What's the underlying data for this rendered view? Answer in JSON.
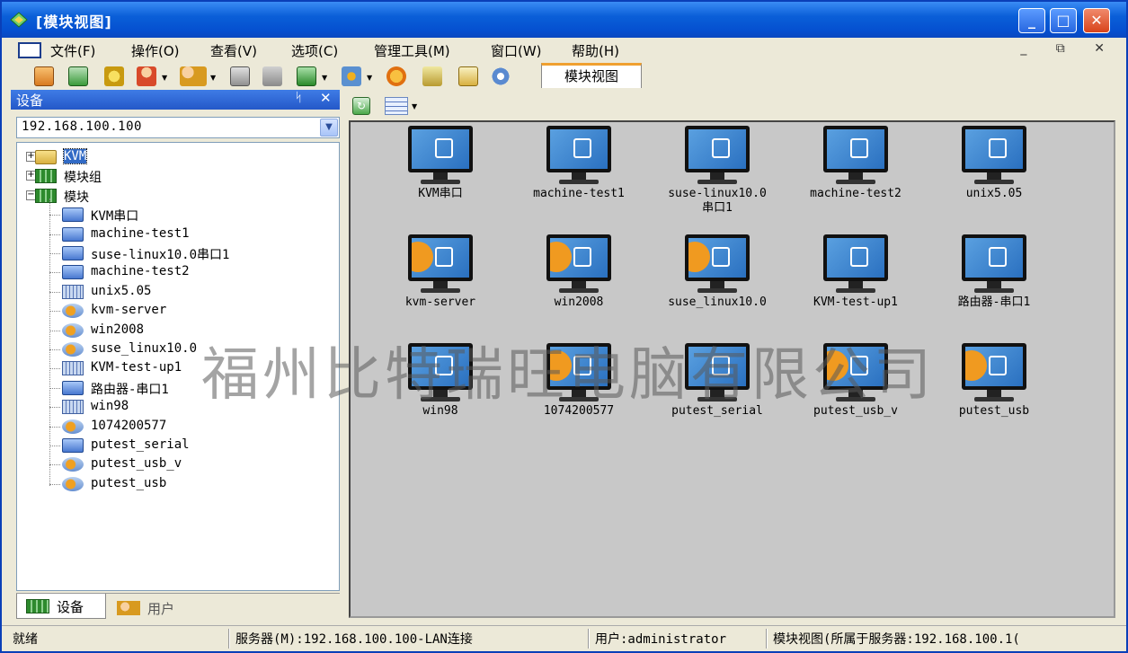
{
  "window": {
    "title": "[模块视图]"
  },
  "menu": [
    "文件(F)",
    "操作(O)",
    "查看(V)",
    "选项(C)",
    "管理工具(M)",
    "窗口(W)",
    "帮助(H)"
  ],
  "mdi_controls": "_ ⧉ ✕",
  "document_tab": "模块视图",
  "left_panel": {
    "title": "设备",
    "pin": "ᛋ",
    "close": "✕",
    "server": "192.168.100.100",
    "tree": [
      {
        "label": "KVM",
        "icon": "folder",
        "level": 0,
        "expander": "+",
        "selected": true
      },
      {
        "label": "模块组",
        "icon": "group",
        "level": 0,
        "expander": "+"
      },
      {
        "label": "模块",
        "icon": "group",
        "level": 0,
        "expander": "−"
      },
      {
        "label": "KVM串口",
        "icon": "serial",
        "level": 1
      },
      {
        "label": "machine-test1",
        "icon": "serial",
        "level": 1
      },
      {
        "label": "suse-linux10.0串口1",
        "icon": "serial",
        "level": 1
      },
      {
        "label": "machine-test2",
        "icon": "serial",
        "level": 1
      },
      {
        "label": "unix5.05",
        "icon": "kbd",
        "level": 1
      },
      {
        "label": "kvm-server",
        "icon": "usb",
        "level": 1
      },
      {
        "label": "win2008",
        "icon": "usb",
        "level": 1
      },
      {
        "label": "suse_linux10.0",
        "icon": "usb",
        "level": 1
      },
      {
        "label": "KVM-test-up1",
        "icon": "kbd",
        "level": 1
      },
      {
        "label": "路由器-串口1",
        "icon": "serial",
        "level": 1
      },
      {
        "label": "win98",
        "icon": "kbd",
        "level": 1
      },
      {
        "label": "1074200577",
        "icon": "usb",
        "level": 1
      },
      {
        "label": "putest_serial",
        "icon": "serial",
        "level": 1
      },
      {
        "label": "putest_usb_v",
        "icon": "usb",
        "level": 1
      },
      {
        "label": "putest_usb",
        "icon": "usb",
        "level": 1
      }
    ],
    "tabs": [
      "设备",
      "用户"
    ]
  },
  "modules": [
    {
      "label": "KVM串口",
      "kind": "serial"
    },
    {
      "label": "machine-test1",
      "kind": "serial"
    },
    {
      "label": "suse-linux10.0\n串口1",
      "kind": "serial"
    },
    {
      "label": "machine-test2",
      "kind": "serial"
    },
    {
      "label": "unix5.05",
      "kind": "kbd"
    },
    {
      "label": "kvm-server",
      "kind": "usb"
    },
    {
      "label": "win2008",
      "kind": "usb"
    },
    {
      "label": "suse_linux10.0",
      "kind": "usb"
    },
    {
      "label": "KVM-test-up1",
      "kind": "kbd"
    },
    {
      "label": "路由器-串口1",
      "kind": "serial"
    },
    {
      "label": "win98",
      "kind": "kbd"
    },
    {
      "label": "1074200577",
      "kind": "usb"
    },
    {
      "label": "putest_serial",
      "kind": "serial"
    },
    {
      "label": "putest_usb_v",
      "kind": "usb"
    },
    {
      "label": "putest_usb",
      "kind": "usb"
    }
  ],
  "watermark": "福州比特瑞旺电脑有限公司",
  "status": {
    "ready": "就绪",
    "server": "服务器(M):192.168.100.100-LAN连接",
    "user": "用户:administrator",
    "view": "模块视图(所属于服务器:192.168.100.1("
  }
}
